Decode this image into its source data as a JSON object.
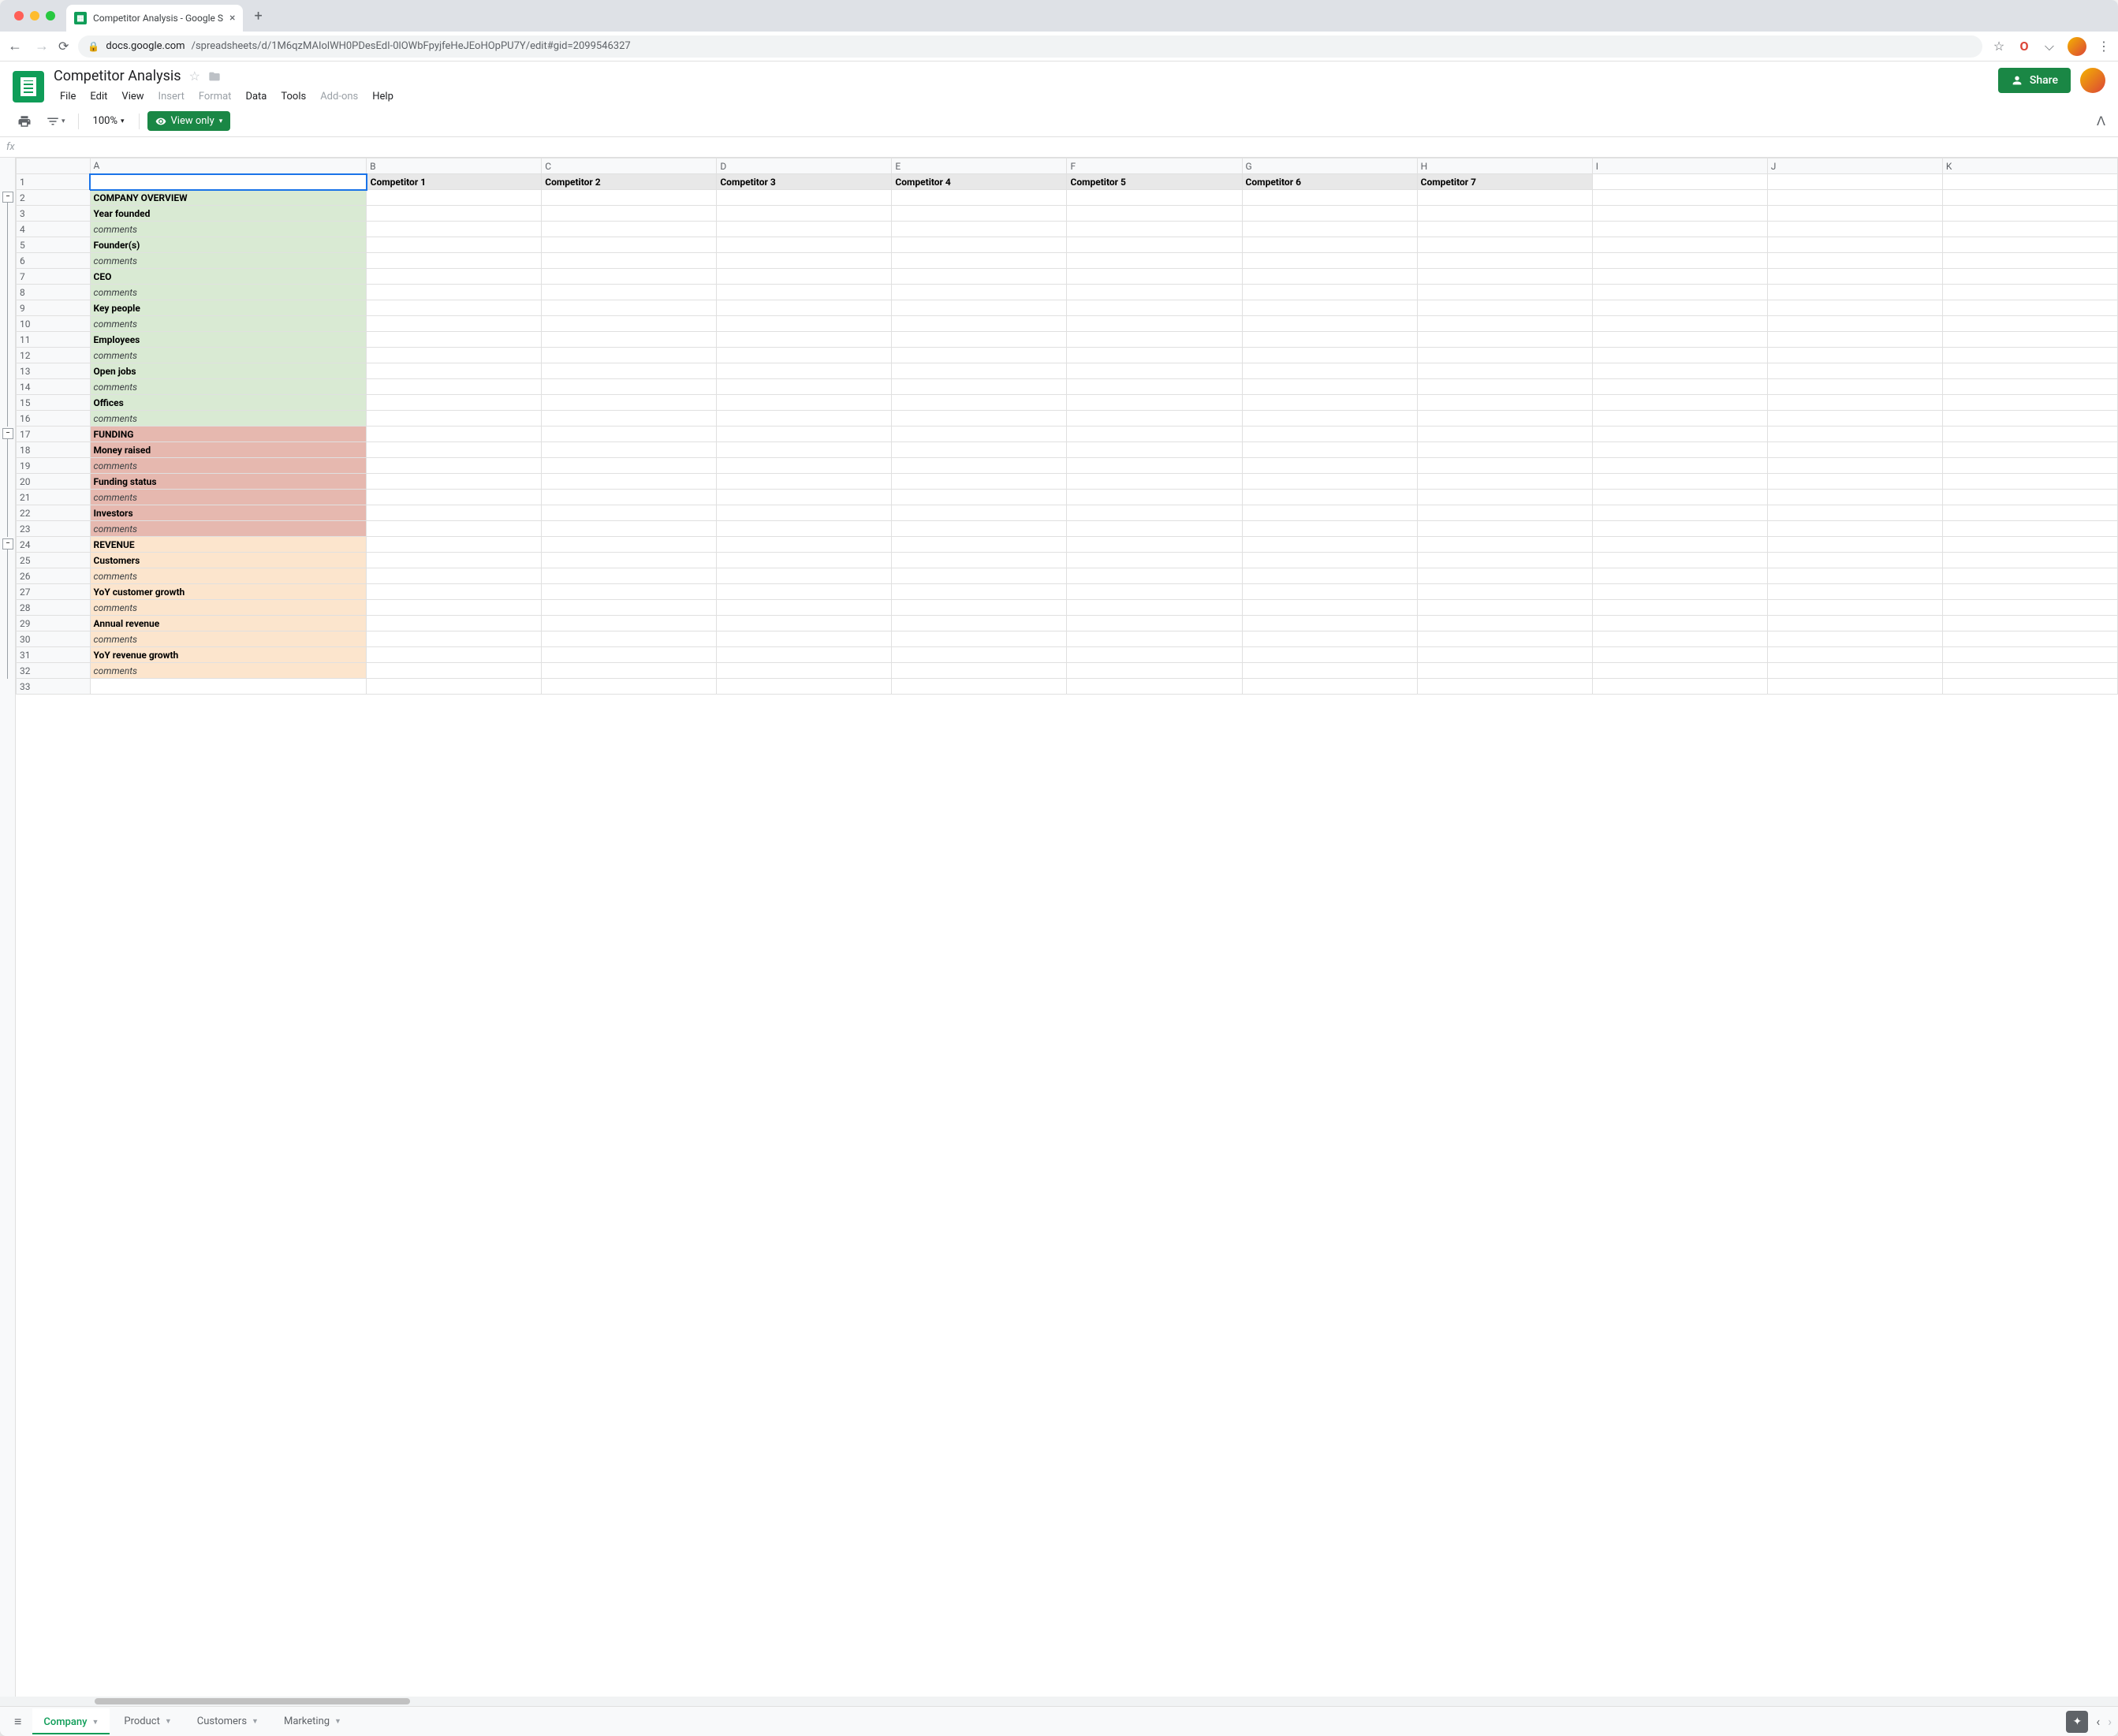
{
  "browser": {
    "tab_title": "Competitor Analysis - Google S",
    "url_host": "docs.google.com",
    "url_path": "/spreadsheets/d/1M6qzMAIolWH0PDesEdI-0lOWbFpyjfeHeJEoHOpPU7Y/edit#gid=2099546327"
  },
  "doc": {
    "title": "Competitor Analysis",
    "menus": [
      "File",
      "Edit",
      "View",
      "Insert",
      "Format",
      "Data",
      "Tools",
      "Add-ons",
      "Help"
    ],
    "menus_disabled": [
      "Insert",
      "Format",
      "Add-ons"
    ],
    "share_label": "Share"
  },
  "toolbar": {
    "zoom": "100%",
    "view_only": "View only"
  },
  "columns": [
    "",
    "A",
    "B",
    "C",
    "D",
    "E",
    "F",
    "G",
    "H",
    "I",
    "J",
    "K"
  ],
  "header_row": {
    "num": 1,
    "cells": [
      "",
      "Competitor 1",
      "Competitor 2",
      "Competitor 3",
      "Competitor 4",
      "Competitor 5",
      "Competitor 6",
      "Competitor 7",
      "",
      "",
      ""
    ]
  },
  "rows": [
    {
      "num": 2,
      "label": "COMPANY OVERVIEW",
      "style": "bold",
      "bg": "green"
    },
    {
      "num": 3,
      "label": "Year founded",
      "style": "bold",
      "bg": "green"
    },
    {
      "num": 4,
      "label": "comments",
      "style": "italic",
      "bg": "green"
    },
    {
      "num": 5,
      "label": "Founder(s)",
      "style": "bold",
      "bg": "green"
    },
    {
      "num": 6,
      "label": "comments",
      "style": "italic",
      "bg": "green"
    },
    {
      "num": 7,
      "label": "CEO",
      "style": "bold",
      "bg": "green"
    },
    {
      "num": 8,
      "label": "comments",
      "style": "italic",
      "bg": "green"
    },
    {
      "num": 9,
      "label": "Key people",
      "style": "bold",
      "bg": "green"
    },
    {
      "num": 10,
      "label": "comments",
      "style": "italic",
      "bg": "green"
    },
    {
      "num": 11,
      "label": "Employees",
      "style": "bold",
      "bg": "green"
    },
    {
      "num": 12,
      "label": "comments",
      "style": "italic",
      "bg": "green"
    },
    {
      "num": 13,
      "label": "Open jobs",
      "style": "bold",
      "bg": "green"
    },
    {
      "num": 14,
      "label": "comments",
      "style": "italic",
      "bg": "green"
    },
    {
      "num": 15,
      "label": "Offices",
      "style": "bold",
      "bg": "green"
    },
    {
      "num": 16,
      "label": "comments",
      "style": "italic",
      "bg": "green"
    },
    {
      "num": 17,
      "label": "FUNDING",
      "style": "bold",
      "bg": "red"
    },
    {
      "num": 18,
      "label": "Money raised",
      "style": "bold",
      "bg": "red"
    },
    {
      "num": 19,
      "label": "comments",
      "style": "italic",
      "bg": "red"
    },
    {
      "num": 20,
      "label": "Funding status",
      "style": "bold",
      "bg": "red"
    },
    {
      "num": 21,
      "label": "comments",
      "style": "italic",
      "bg": "red"
    },
    {
      "num": 22,
      "label": "Investors",
      "style": "bold",
      "bg": "red"
    },
    {
      "num": 23,
      "label": "comments",
      "style": "italic",
      "bg": "red"
    },
    {
      "num": 24,
      "label": "REVENUE",
      "style": "bold",
      "bg": "orange"
    },
    {
      "num": 25,
      "label": "Customers",
      "style": "bold",
      "bg": "orange"
    },
    {
      "num": 26,
      "label": "comments",
      "style": "italic",
      "bg": "orange"
    },
    {
      "num": 27,
      "label": "YoY customer growth",
      "style": "bold",
      "bg": "orange"
    },
    {
      "num": 28,
      "label": "comments",
      "style": "italic",
      "bg": "orange"
    },
    {
      "num": 29,
      "label": "Annual revenue",
      "style": "bold",
      "bg": "orange"
    },
    {
      "num": 30,
      "label": "comments",
      "style": "italic",
      "bg": "orange"
    },
    {
      "num": 31,
      "label": "YoY revenue growth",
      "style": "bold",
      "bg": "orange"
    },
    {
      "num": 32,
      "label": "comments",
      "style": "italic",
      "bg": "orange"
    },
    {
      "num": 33,
      "label": "",
      "style": "",
      "bg": ""
    }
  ],
  "sheet_tabs": [
    "Company",
    "Product",
    "Customers",
    "Marketing"
  ],
  "active_sheet": "Company",
  "outline_groups": [
    {
      "start": 2,
      "end": 16
    },
    {
      "start": 17,
      "end": 23
    },
    {
      "start": 24,
      "end": 32
    }
  ]
}
